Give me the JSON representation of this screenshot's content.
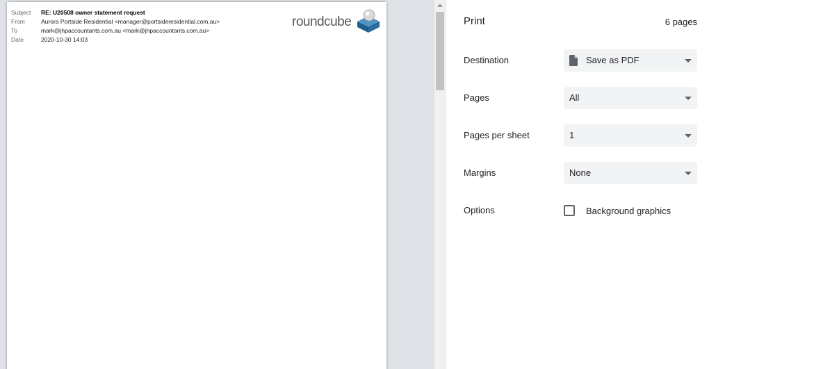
{
  "preview": {
    "header": {
      "subject_label": "Subject",
      "subject_value": "RE: U20508 owner statement request",
      "from_label": "From",
      "from_value": "Aurora Portside Residential <manager@portsideresidential.com.au>",
      "to_label": "To",
      "to_value": "mark@jhpaccountants.com.au <mark@jhpaccountants.com.au>",
      "date_label": "Date",
      "date_value": "2020-10-30 14:03"
    },
    "logo_text": "roundcube"
  },
  "settings": {
    "title": "Print",
    "page_count": "6 pages",
    "destination": {
      "label": "Destination",
      "value": "Save as PDF",
      "icon": "document-icon"
    },
    "pages": {
      "label": "Pages",
      "value": "All"
    },
    "pages_per_sheet": {
      "label": "Pages per sheet",
      "value": "1"
    },
    "margins": {
      "label": "Margins",
      "value": "None"
    },
    "options": {
      "label": "Options",
      "background_graphics_label": "Background graphics",
      "background_graphics_checked": false
    }
  },
  "colors": {
    "preview_bg": "#dee1e6",
    "select_bg": "#f1f3f4",
    "text": "#202124",
    "icon": "#5f6368",
    "logo_blue": "#2a6f9e"
  }
}
